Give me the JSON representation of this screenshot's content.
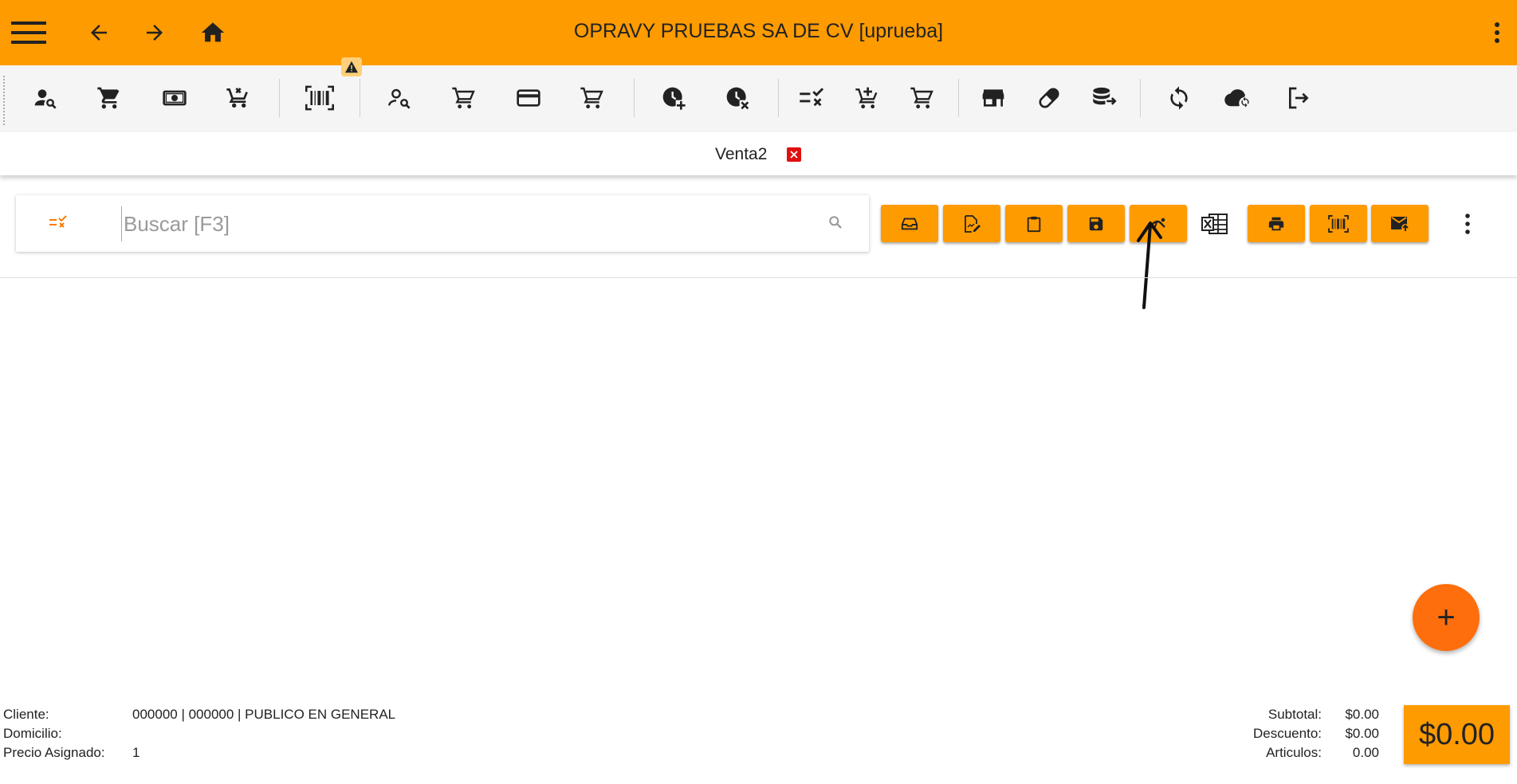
{
  "header": {
    "title": "OPRAVY PRUEBAS SA DE CV [uprueba]",
    "icons": [
      "menu-icon",
      "arrow-left-icon",
      "arrow-right-icon",
      "home-icon",
      "more-vert-icon"
    ],
    "color": "#fe9b00"
  },
  "toolbar": {
    "icons": [
      "customer-search-icon",
      "cart-icon",
      "cash-icon",
      "cart-remove-icon",
      "barcode-scan-icon",
      "customer-search-outline-icon",
      "cart-outline-icon",
      "credit-card-icon",
      "cart-outline-icon",
      "clock-add-icon",
      "clock-remove-icon",
      "checklist-remove-icon",
      "cart-add-icon",
      "cart-outline-icon",
      "store-icon",
      "pill-icon",
      "database-export-icon",
      "sync-icon",
      "cloud-sync-icon",
      "logout-icon"
    ],
    "warning_icon": "warning-icon"
  },
  "tabs": [
    {
      "label": "Venta2",
      "close_icon": "close-icon"
    }
  ],
  "search": {
    "placeholder": "Buscar [F3]",
    "value": ""
  },
  "actions": {
    "icons": [
      "inbox-icon",
      "edit-document-icon",
      "clipboard-icon",
      "save-icon",
      "person-walk-icon",
      "excel-icon",
      "print-icon",
      "barcode-icon",
      "email-send-icon",
      "more-vert-icon"
    ]
  },
  "fab": {
    "label": "+"
  },
  "footer": {
    "cliente_label": "Cliente:",
    "cliente_value": "000000 | 000000 | PUBLICO EN GENERAL",
    "domicilio_label": "Domicilio:",
    "domicilio_value": "",
    "precio_label": "Precio Asignado:",
    "precio_value": "1",
    "subtotal_label": "Subtotal:",
    "subtotal_value": "$0.00",
    "descuento_label": "Descuento:",
    "descuento_value": "$0.00",
    "articulos_label": "Articulos:",
    "articulos_value": "0.00",
    "total": "$0.00"
  },
  "colors": {
    "accent": "#fe9b00",
    "fab": "#fe6e0d",
    "close": "#e01010"
  }
}
